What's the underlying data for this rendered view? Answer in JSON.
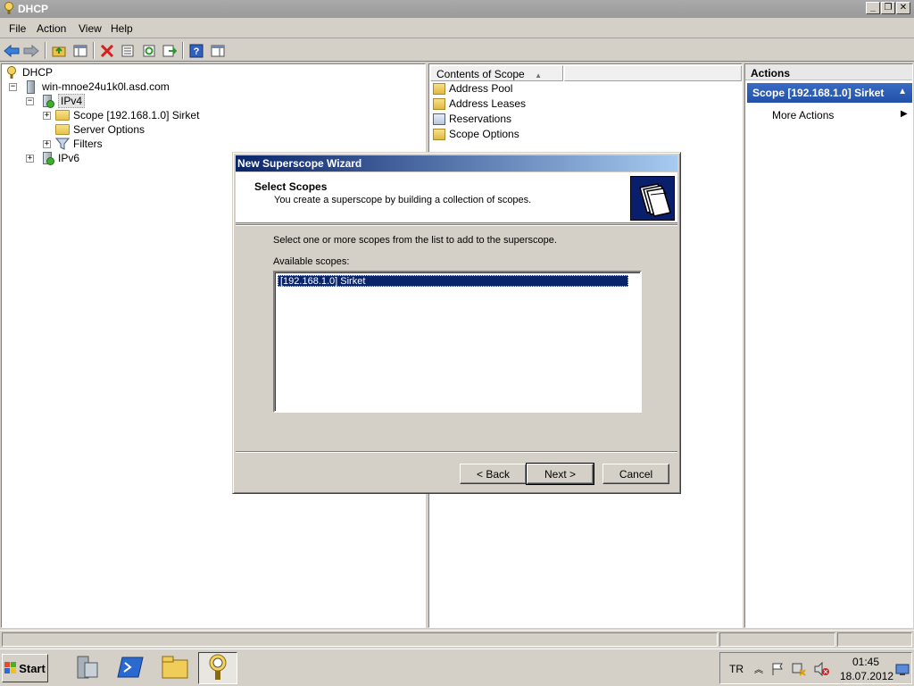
{
  "window": {
    "title": "DHCP"
  },
  "menubar": {
    "items": [
      "File",
      "Action",
      "View",
      "Help"
    ]
  },
  "tree": {
    "root": "DHCP",
    "server": "win-mnoe24u1k0l.asd.com",
    "ipv4": "IPv4",
    "scope": "Scope [192.168.1.0] Sirket",
    "server_options": "Server Options",
    "filters": "Filters",
    "ipv6": "IPv6"
  },
  "content": {
    "column_header": "Contents of Scope",
    "items": [
      "Address Pool",
      "Address Leases",
      "Reservations",
      "Scope Options"
    ]
  },
  "actions": {
    "header": "Actions",
    "section_title": "Scope [192.168.1.0] Sirket",
    "more_actions": "More Actions"
  },
  "wizard": {
    "title": "New Superscope Wizard",
    "heading": "Select Scopes",
    "subheading": "You create a superscope by building a collection of scopes.",
    "intro": "Select one or more scopes from the list to add to the superscope.",
    "list_label": "Available scopes:",
    "list_items": [
      "[192.168.1.0] Sirket"
    ],
    "back_label": "< Back",
    "next_label": "Next >",
    "cancel_label": "Cancel"
  },
  "taskbar": {
    "start_label": "Start",
    "language": "TR",
    "time": "01:45",
    "date": "18.07.2012"
  },
  "colors": {
    "wizard_title_start": "#0a246a",
    "selection": "#0a246a",
    "actions_section": "#2150a8"
  }
}
